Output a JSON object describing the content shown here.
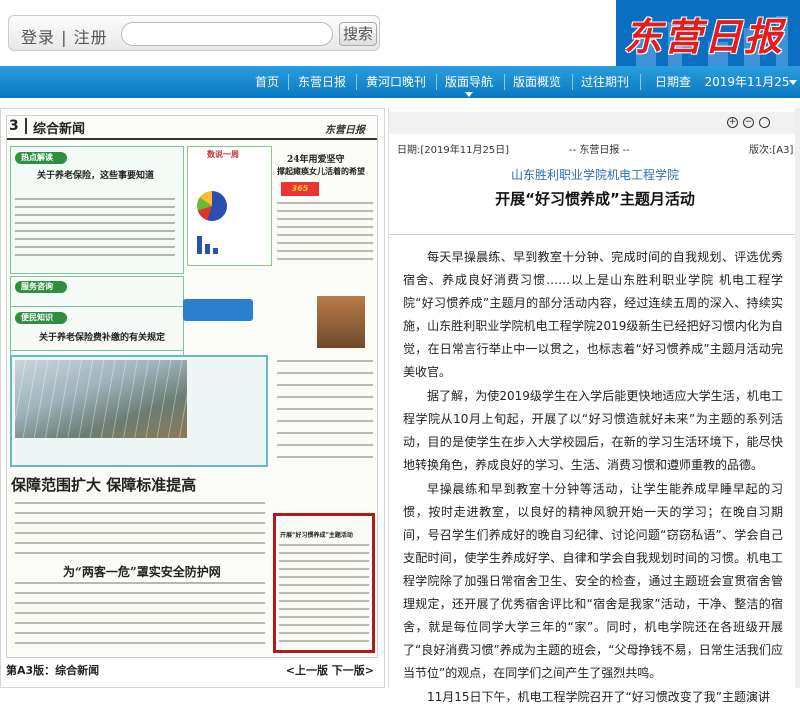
{
  "header": {
    "login": "登录",
    "divider": "|",
    "register": "注册",
    "search_button": "搜索",
    "logo_text": "东营日报"
  },
  "nav": {
    "items": [
      {
        "label": "首页"
      },
      {
        "label": "东营日报"
      },
      {
        "label": "黄河口晚刊"
      },
      {
        "label": "版面导航"
      },
      {
        "label": "版面概览"
      },
      {
        "label": "过往期刊"
      }
    ],
    "date_query_label": "日期查询：",
    "date_query_value": "2019年11月25日"
  },
  "paper": {
    "page_no": "3",
    "section": "综合新闻",
    "masthead": "东营日报",
    "headlines": {
      "h1": "关于养老保险，这些事要知道",
      "h2": "24年用爱坚守",
      "h3": "撑起瘫痪女儿活着的希望",
      "h4": "关于养老保险费补缴的有关规定",
      "h5": "保障范围扩大  保障标准提高",
      "h6": "为“两客一危”罩实安全防护网",
      "data_box": "数说一周",
      "tag1": "热点解读",
      "tag2": "服务咨询",
      "tag3": "便民知识",
      "small1": "开展“好习惯养成”主题活动"
    },
    "footer_left": "第A3版：综合新闻",
    "footer_right": "<上一版  下一版>"
  },
  "article": {
    "date": "日期:[2019年11月25日]",
    "source": "-- 东营日报 --",
    "page": "版次:[A3]",
    "subtitle": "山东胜利职业学院机电工程学院",
    "title": "开展“好习惯养成”主题月活动",
    "paragraphs": [
      "每天早操晨练、早到教室十分钟、完成时间的自我规划、评选优秀宿舍、养成良好消费习惯……以上是山东胜利职业学院 机电工程学院“好习惯养成”主题月的部分活动内容，经过连续五周的深入、持续实施，山东胜利职业学院机电工程学院2019级新生已经把好习惯内化为自觉，在日常言行举止中一以贯之，也标志着“好习惯养成”主题月活动完美收官。",
      "据了解，为使2019级学生在入学后能更快地适应大学生活，机电工程学院从10月上旬起，开展了以“好习惯造就好未来”为主题的系列活动，目的是使学生在步入大学校园后，在新的学习生活环境下，能尽快地转换角色，养成良好的学习、生活、消费习惯和遵师重教的品德。",
      "早操晨练和早到教室十分钟等活动，让学生能养成早睡早起的习惯，按时走进教室，以良好的精神风貌开始一天的学习；在晚自习期间，号召学生们养成好的晚自习纪律、讨论问题“窃窃私语”、学会自己支配时间，使学生养成好学、自律和学会自我规划时间的习惯。机电工程学院除了加强日常宿舍卫生、安全的检查，通过主题班会宣贯宿舍管理规定，还开展了优秀宿舍评比和“宿舍是我家”活动，干净、整洁的宿舍，就是每位同学大学三年的“家”。同时，机电学院还在各班级开展了“良好消费习惯”养成为主题的班会，“父母挣钱不易，日常生活我们应当节位”的观点，在同学们之间产生了强烈共鸣。",
      "11月15日下午，机电工程学院召开了“好习惯改变了我”主题演讲"
    ]
  },
  "colors": {
    "nav_blue": "#0b78c2",
    "logo_red": "#e21d1d",
    "subtitle_blue": "#2a6fb8",
    "highlight_red": "#b01c1c",
    "green_tag": "#2f8f3e"
  }
}
